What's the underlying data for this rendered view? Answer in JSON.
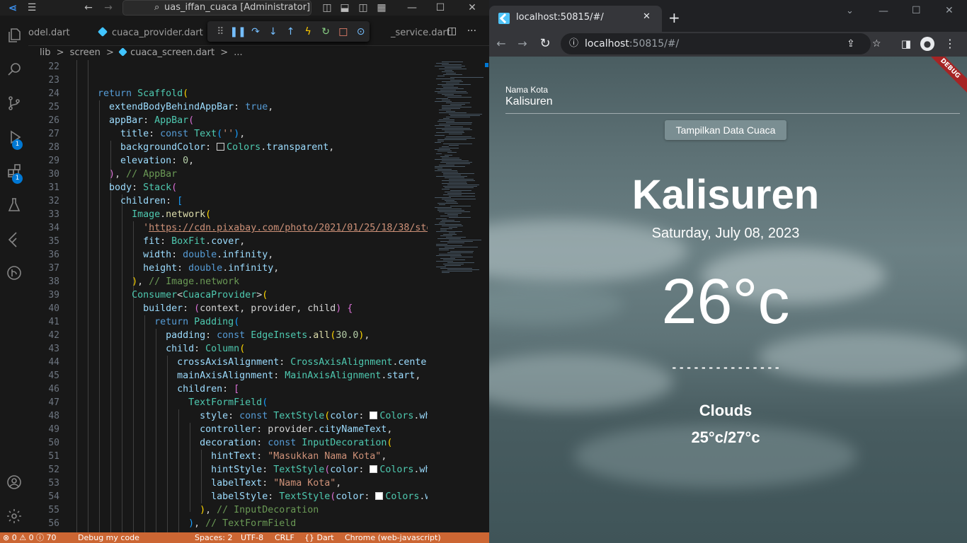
{
  "vscode": {
    "window_title": "uas_iffan_cuaca [Administrator]",
    "tabs": [
      "odel.dart",
      "cuaca_provider.dart",
      "_service.dart"
    ],
    "breadcrumb": [
      "lib",
      ">",
      "screen",
      ">",
      "cuaca_screen.dart",
      ">",
      "..."
    ],
    "line_numbers": [
      "22",
      "23",
      "24",
      "25",
      "26",
      "27",
      "28",
      "29",
      "30",
      "31",
      "32",
      "33",
      "34",
      "35",
      "36",
      "37",
      "38",
      "39",
      "40",
      "41",
      "42",
      "43",
      "44",
      "45",
      "46",
      "47",
      "48",
      "49",
      "50",
      "51",
      "52",
      "53",
      "54",
      "55",
      "56"
    ],
    "badges": {
      "run_debug": "1",
      "extensions": "1"
    },
    "status": {
      "problems": "⊗ 0 ⚠ 0 ⓘ 70",
      "debug": "Debug my code",
      "spaces": "Spaces: 2",
      "encoding": "UTF-8",
      "eol": "CRLF",
      "language": "{} Dart",
      "device": "Chrome (web-javascript)"
    },
    "colors": {
      "status_bar": "#cc6633",
      "accent": "#0078d4"
    }
  },
  "chrome": {
    "tab_title": "localhost:50815/#/",
    "address_host": "localhost",
    "address_rest": ":50815/#/"
  },
  "app": {
    "input_label": "Nama Kota",
    "input_value": "Kalisuren",
    "button_label": "Tampilkan Data Cuaca",
    "city": "Kalisuren",
    "date": "Saturday, July 08, 2023",
    "temperature": "26°c",
    "divider": "- - - - - - - - - - - - - - -",
    "condition": "Clouds",
    "min_max": "25°c/27°c",
    "debug_banner": "DEBUG"
  }
}
